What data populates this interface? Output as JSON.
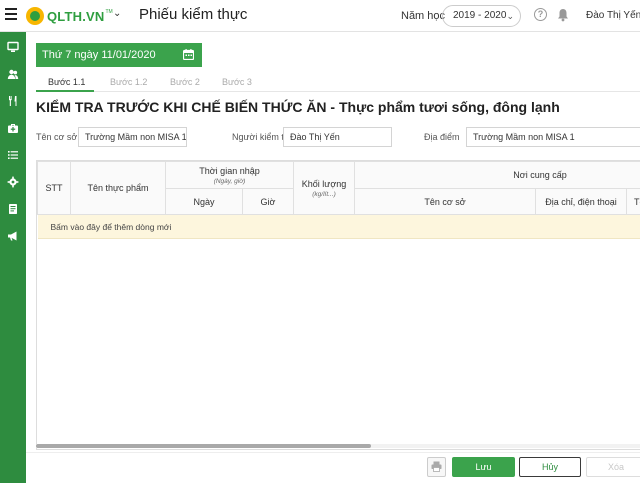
{
  "header": {
    "logo_text": "QLTH.VN",
    "logo_tm": "TM",
    "page_title": "Phiếu kiểm thực",
    "year_label": "Năm học",
    "year_value": "2019 - 2020",
    "user_name": "Đào Thị Yến"
  },
  "sidebar": {
    "icons": [
      "monitor-icon",
      "users-icon",
      "utensils-icon",
      "medkit-icon",
      "list-icon",
      "gear-icon",
      "document-icon",
      "megaphone-icon"
    ]
  },
  "date_chip": "Thứ 7 ngày 11/01/2020",
  "steps": [
    "Bước 1.1",
    "Bước 1.2",
    "Bước 2",
    "Bước 3"
  ],
  "section_title": "KIỂM TRA TRƯỚC KHI CHẾ BIẾN THỨC ĂN - Thực phẩm tươi sống, đông lạnh",
  "form": {
    "facility_label": "Tên cơ sở",
    "facility_value": "Trường Mầm non MISA 1",
    "inspector_label": "Người kiểm tra",
    "inspector_value": "Đào Thị Yến",
    "location_label": "Địa điểm",
    "location_value": "Trường Mầm non MISA 1"
  },
  "table": {
    "col_stt": "STT",
    "col_food": "Tên thực phẩm",
    "col_time": "Thời gian nhập",
    "col_time_sub": "(Ngày, giờ)",
    "col_date": "Ngày",
    "col_hour": "Giờ",
    "col_weight": "Khối lượng",
    "col_weight_sub": "(kg/lít...)",
    "col_supplier": "Nơi cung cấp",
    "col_supplier_name": "Tên cơ sở",
    "col_address": "Địa chỉ, điện thoại",
    "col_deliverer": "Tên người giao hàng",
    "add_row_text": "Bấm vào đây để thêm dòng mới"
  },
  "footer": {
    "save_label": "Lưu",
    "cancel_label": "Hủy",
    "delete_label": "Xóa"
  },
  "colors": {
    "brand_green": "#3ba34c",
    "sidebar_green": "#2e8c3f",
    "add_row_bg": "#fdf6dd"
  }
}
